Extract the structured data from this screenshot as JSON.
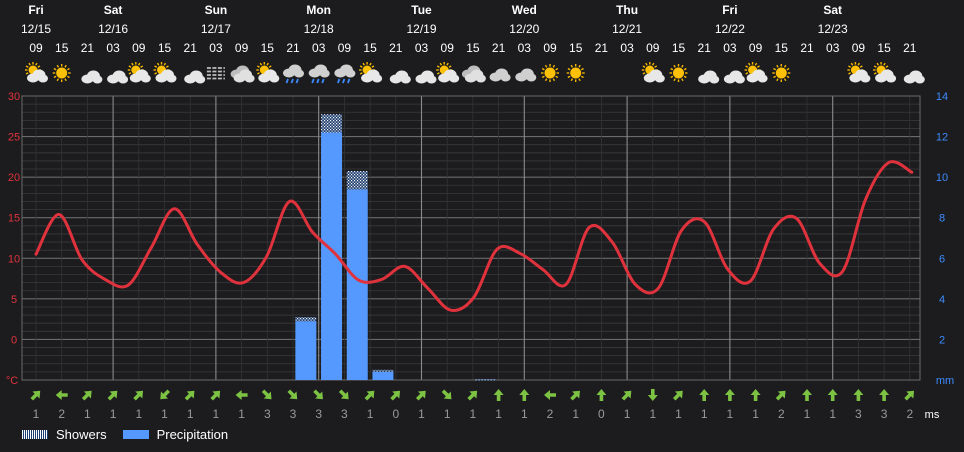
{
  "chart_data": {
    "type": "line",
    "title": "",
    "days": [
      {
        "name": "Fri",
        "date": "12/15"
      },
      {
        "name": "Sat",
        "date": "12/16"
      },
      {
        "name": "Sun",
        "date": "12/17"
      },
      {
        "name": "Mon",
        "date": "12/18"
      },
      {
        "name": "Tue",
        "date": "12/19"
      },
      {
        "name": "Wed",
        "date": "12/20"
      },
      {
        "name": "Thu",
        "date": "12/21"
      },
      {
        "name": "Fri",
        "date": "12/22"
      },
      {
        "name": "Sat",
        "date": "12/23"
      }
    ],
    "hours": [
      "09",
      "15",
      "21",
      "03",
      "09",
      "15",
      "21",
      "03",
      "09",
      "15",
      "21",
      "03",
      "09",
      "15",
      "21",
      "03",
      "09",
      "15",
      "21",
      "03",
      "09",
      "15",
      "21",
      "03",
      "09",
      "15",
      "21",
      "03",
      "09",
      "15",
      "21",
      "03",
      "09",
      "15",
      "21"
    ],
    "weather_icons": [
      "partly-cloudy-day",
      "sunny",
      "moon-cloud",
      "moon-cloud",
      "partly-cloudy-day",
      "partly-cloudy-day",
      "moon-cloud",
      "fog",
      "cloudy",
      "partly-cloudy-day",
      "rain-cloud",
      "rain-cloud",
      "rain-cloud",
      "partly-cloudy-day",
      "moon-cloud",
      "moon-cloud",
      "partly-cloudy-day",
      "cloudy",
      "cloudy-night",
      "cloudy-night",
      "sunny",
      "sunny",
      "moon",
      "moon",
      "partly-cloudy-day",
      "sunny",
      "moon-cloud",
      "moon-cloud",
      "partly-cloudy-day",
      "sunny",
      "moon",
      "moon",
      "partly-cloudy-day",
      "partly-cloudy-day",
      "moon-cloud"
    ],
    "temperature": {
      "name": "Temperature",
      "color": "#e0323c",
      "values": [
        10.5,
        15.4,
        9.8,
        7.4,
        6.7,
        11.3,
        16.1,
        11.7,
        8.3,
        7.0,
        10.2,
        17.0,
        13.2,
        10.5,
        7.3,
        7.4,
        9.0,
        6.3,
        3.6,
        5.2,
        11.1,
        10.6,
        8.6,
        6.8,
        13.8,
        12.0,
        6.8,
        6.3,
        13.4,
        14.5,
        8.7,
        7.2,
        13.6,
        14.9,
        9.4,
        8.4,
        17.3,
        21.8,
        20.6
      ]
    },
    "precipitation": {
      "name": "Precipitation",
      "color": "#5599ff",
      "values": [
        0,
        0,
        0,
        0,
        0,
        0,
        0,
        0,
        0,
        0,
        2.9,
        12.2,
        9.4,
        0.4,
        0,
        0,
        0,
        0,
        0,
        0,
        0,
        0,
        0,
        0,
        0,
        0,
        0,
        0,
        0,
        0,
        0,
        0,
        0,
        0,
        0
      ]
    },
    "showers": {
      "name": "Showers",
      "values": [
        0,
        0,
        0,
        0,
        0,
        0,
        0,
        0,
        0,
        0,
        0.2,
        0.9,
        0.9,
        0.1,
        0,
        0,
        0,
        0.05,
        0,
        0,
        0,
        0,
        0,
        0,
        0,
        0,
        0,
        0,
        0,
        0,
        0,
        0,
        0,
        0,
        0
      ]
    },
    "wind_direction_arrows": [
      "up-right",
      "left",
      "up-right",
      "up-right",
      "up-right",
      "down-left",
      "up-right",
      "up-right",
      "left",
      "down-right",
      "down-right",
      "down-right",
      "down-right",
      "up-right",
      "up-right",
      "up-right",
      "down-right",
      "up-right",
      "up",
      "up",
      "left",
      "up-right",
      "up",
      "up-right",
      "down",
      "up-right",
      "up",
      "up",
      "up",
      "up-right",
      "up",
      "up",
      "up",
      "up",
      "up-right"
    ],
    "wind_speed": [
      "1",
      "2",
      "1",
      "1",
      "1",
      "1",
      "1",
      "1",
      "1",
      "3",
      "3",
      "3",
      "3",
      "1",
      "0",
      "1",
      "1",
      "1",
      "1",
      "1",
      "2",
      "1",
      "0",
      "1",
      "1",
      "1",
      "1",
      "1",
      "1",
      "2",
      "1",
      "1",
      "3",
      "3",
      "2"
    ],
    "y_left": {
      "unit": "°C",
      "ticks": [
        "30",
        "25",
        "20",
        "15",
        "10",
        "5",
        "0"
      ],
      "ylim": [
        -5,
        30
      ]
    },
    "y_right": {
      "unit": "mm",
      "ticks": [
        "14",
        "12",
        "10",
        "8",
        "6",
        "4",
        "2"
      ],
      "ylim": [
        0,
        14
      ]
    },
    "wind_unit": "ms",
    "grid": true,
    "legend": {
      "position": "bottom-left",
      "items": [
        "Showers",
        "Precipitation"
      ]
    }
  }
}
